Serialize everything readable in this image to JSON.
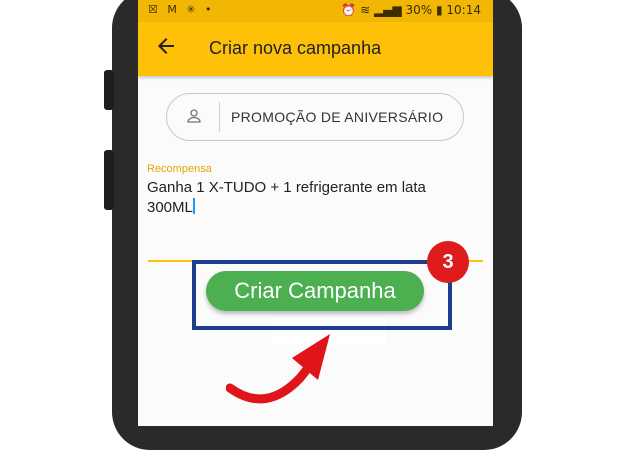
{
  "status_bar": {
    "left_icons": "☒ M ✳ •",
    "battery": "30%",
    "time": "10:14"
  },
  "app_bar": {
    "back_icon": "arrow-left-icon",
    "title": "Criar nova campanha"
  },
  "campaign": {
    "icon": "person-icon",
    "name": "PROMOÇÃO DE ANIVERSÁRIO"
  },
  "reward": {
    "label": "Recompensa",
    "value_line1": "Ganha 1 X-TUDO + 1 refrigerante em lata",
    "value_line2": "300ML"
  },
  "primary_button": {
    "label": "Criar Campanha"
  },
  "annotation": {
    "step_number": "3"
  },
  "colors": {
    "accent": "#ffc107",
    "button": "#4caf50",
    "badge": "#e01b1b",
    "highlight": "#1e3d8f",
    "arrow": "#e0151c"
  }
}
